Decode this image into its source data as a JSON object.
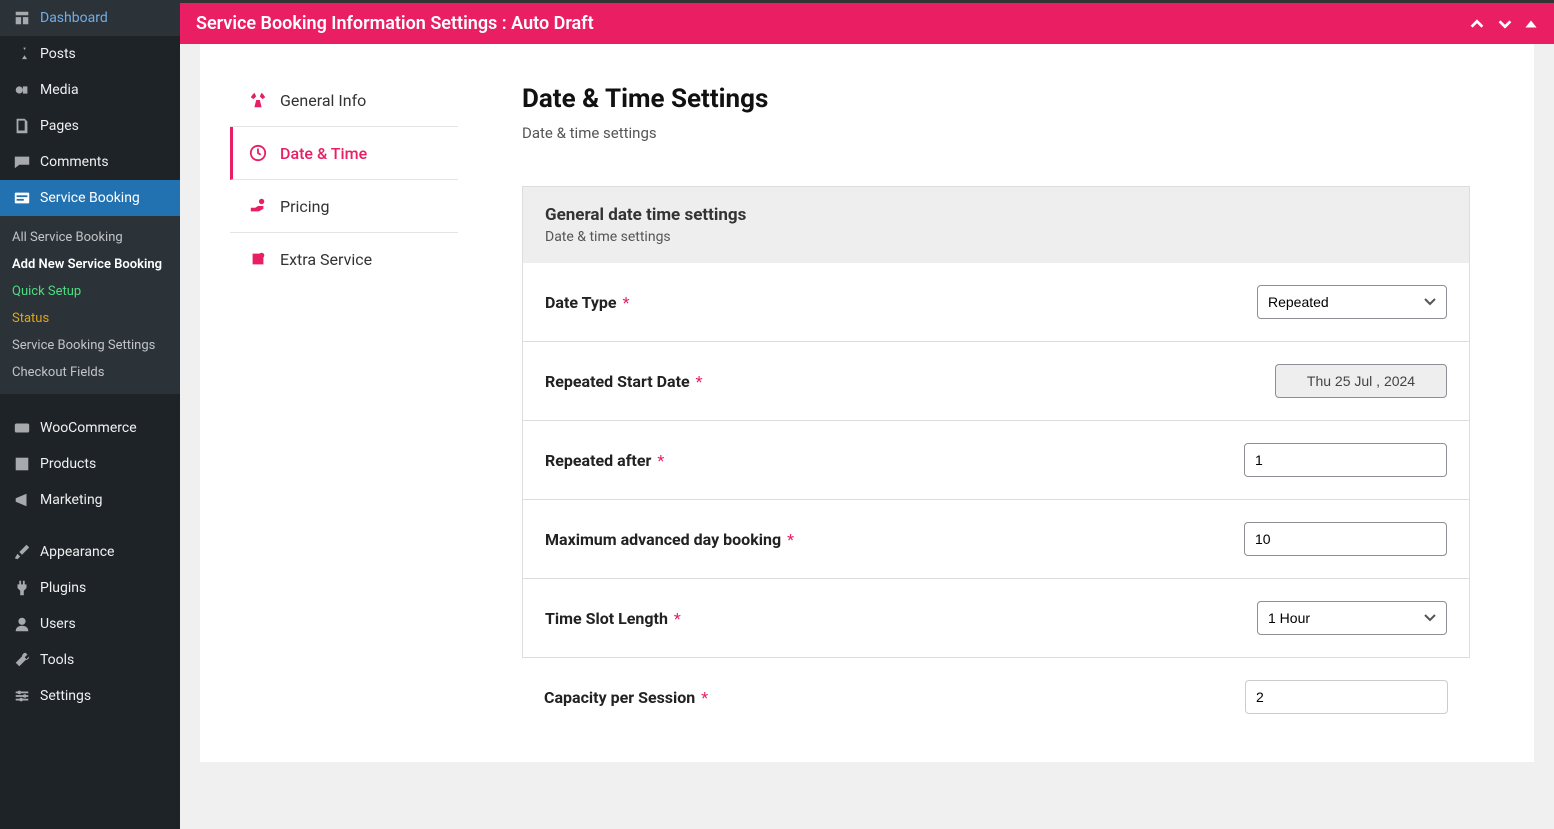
{
  "sidebar": {
    "items": [
      {
        "label": "Dashboard"
      },
      {
        "label": "Posts"
      },
      {
        "label": "Media"
      },
      {
        "label": "Pages"
      },
      {
        "label": "Comments"
      },
      {
        "label": "Service Booking"
      },
      {
        "label": "WooCommerce"
      },
      {
        "label": "Products"
      },
      {
        "label": "Marketing"
      },
      {
        "label": "Appearance"
      },
      {
        "label": "Plugins"
      },
      {
        "label": "Users"
      },
      {
        "label": "Tools"
      },
      {
        "label": "Settings"
      }
    ],
    "sub": [
      {
        "label": "All Service Booking"
      },
      {
        "label": "Add New Service Booking"
      },
      {
        "label": "Quick Setup"
      },
      {
        "label": "Status"
      },
      {
        "label": "Service Booking Settings"
      },
      {
        "label": "Checkout Fields"
      }
    ]
  },
  "header": {
    "title": "Service Booking Information Settings : Auto Draft"
  },
  "tabs": [
    {
      "label": "General Info"
    },
    {
      "label": "Date & Time"
    },
    {
      "label": "Pricing"
    },
    {
      "label": "Extra Service"
    }
  ],
  "section": {
    "title": "Date & Time Settings",
    "subtitle": "Date & time settings"
  },
  "block": {
    "title": "General date time settings",
    "subtitle": "Date & time settings"
  },
  "fields": {
    "date_type": {
      "label": "Date Type",
      "value": "Repeated"
    },
    "start_date": {
      "label": "Repeated Start Date",
      "value": "Thu 25 Jul , 2024"
    },
    "repeated_after": {
      "label": "Repeated after",
      "value": "1"
    },
    "max_advance": {
      "label": "Maximum advanced day booking",
      "value": "10"
    },
    "slot_length": {
      "label": "Time Slot Length",
      "value": "1 Hour"
    },
    "capacity": {
      "label": "Capacity per Session",
      "value": "2"
    }
  }
}
